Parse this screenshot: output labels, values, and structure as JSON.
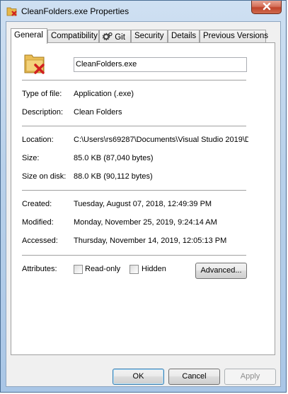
{
  "window": {
    "title": "CleanFolders.exe Properties"
  },
  "tabs": [
    {
      "label": "General",
      "active": true
    },
    {
      "label": "Compatibility"
    },
    {
      "label": "Git"
    },
    {
      "label": "Security"
    },
    {
      "label": "Details"
    },
    {
      "label": "Previous Versions"
    }
  ],
  "general": {
    "filename": "CleanFolders.exe",
    "type_label": "Type of file:",
    "type_value": "Application (.exe)",
    "description_label": "Description:",
    "description_value": "Clean Folders",
    "location_label": "Location:",
    "location_value": "C:\\Users\\rs69287\\Documents\\Visual Studio 2019\\D",
    "size_label": "Size:",
    "size_value": "85.0 KB (87,040 bytes)",
    "size_on_disk_label": "Size on disk:",
    "size_on_disk_value": "88.0 KB (90,112 bytes)",
    "created_label": "Created:",
    "created_value": "Tuesday, August 07, 2018, 12:49:39 PM",
    "modified_label": "Modified:",
    "modified_value": "Monday, November 25, 2019, 9:24:14 AM",
    "accessed_label": "Accessed:",
    "accessed_value": "Thursday, November 14, 2019, 12:05:13 PM",
    "attributes_label": "Attributes:",
    "readonly_label": "Read-only",
    "hidden_label": "Hidden",
    "advanced_label": "Advanced..."
  },
  "buttons": {
    "ok": "OK",
    "cancel": "Cancel",
    "apply": "Apply"
  },
  "icons": {
    "app": "folder-red-x-icon",
    "close": "close-icon",
    "git": "git-gear-icon"
  },
  "colors": {
    "close_red": "#c0442b",
    "accent": "#3c7fb1"
  }
}
